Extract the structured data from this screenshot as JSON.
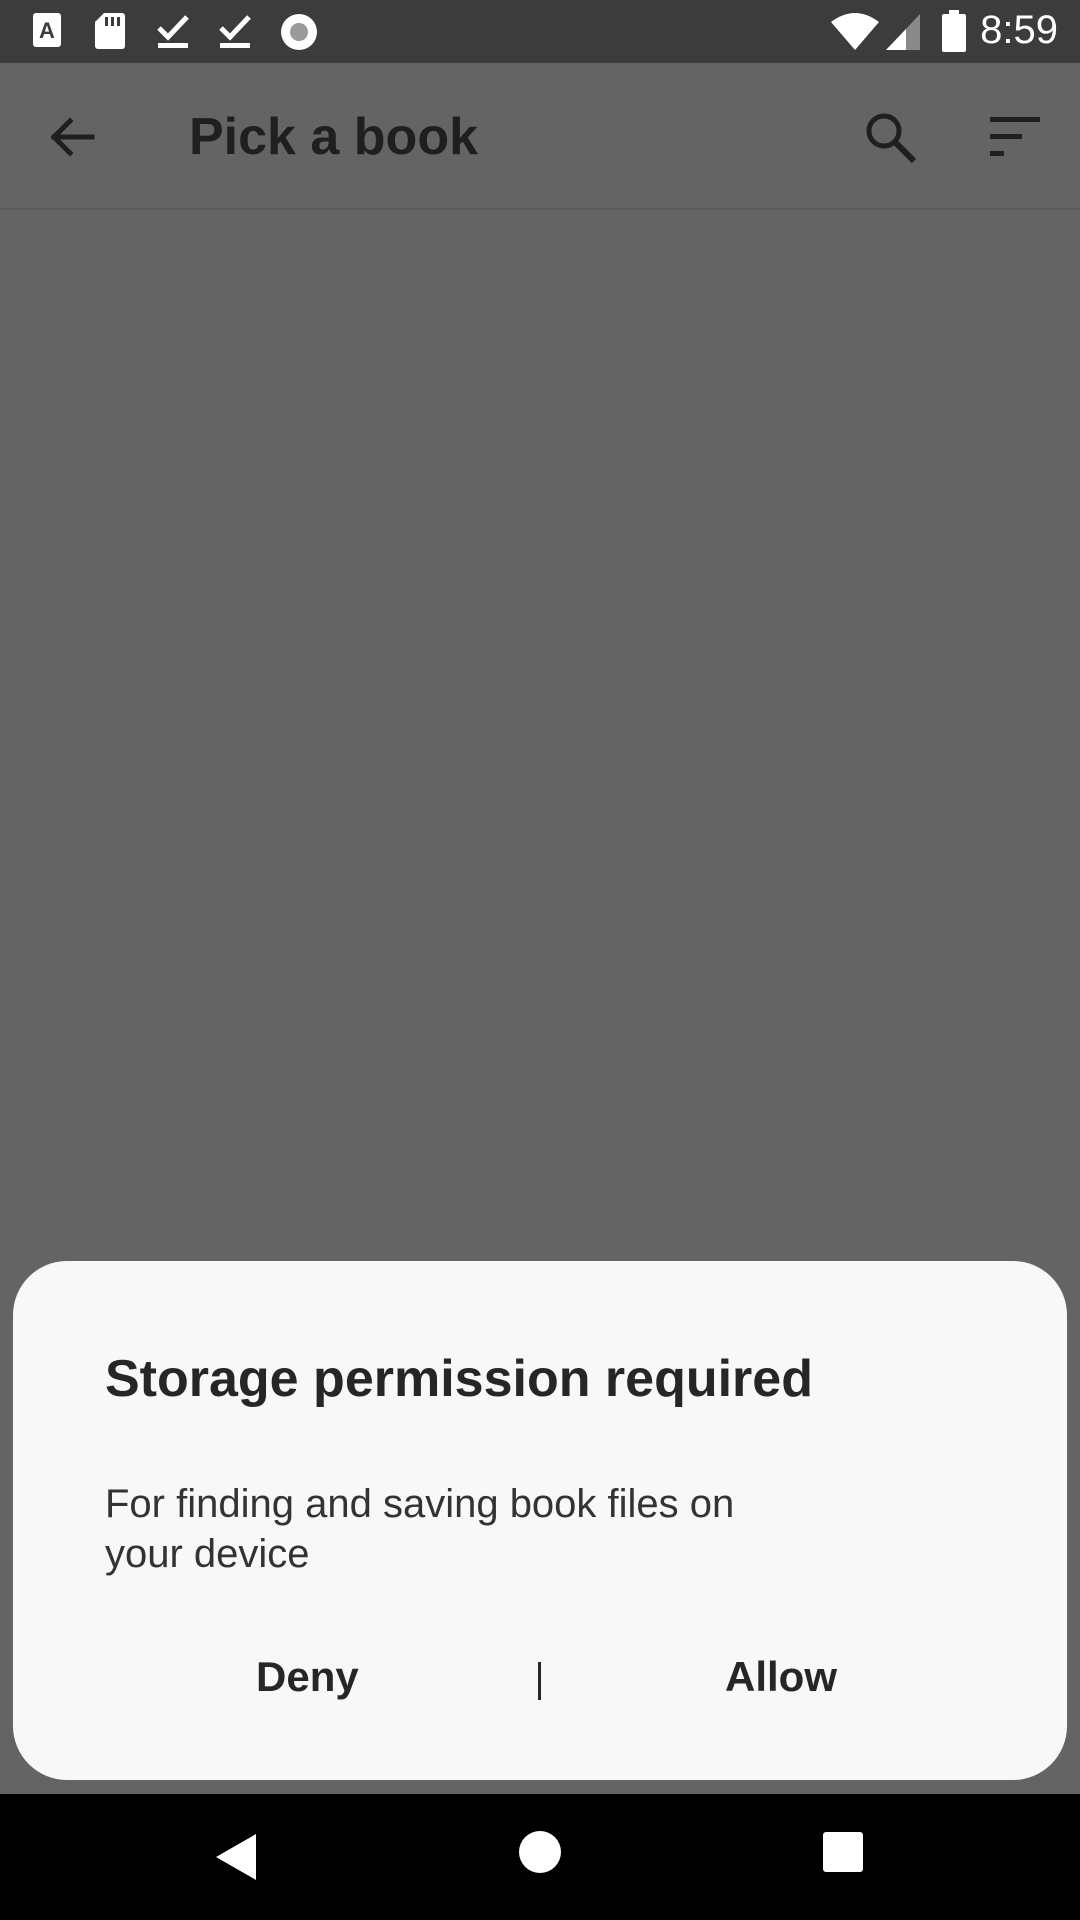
{
  "status_bar": {
    "time": "8:59",
    "icons": [
      "text-a-icon",
      "sd-card-icon",
      "download-done-icon",
      "download-done-icon",
      "record-icon",
      "wifi-icon",
      "signal-icon",
      "battery-icon"
    ]
  },
  "app_bar": {
    "title": "Pick a book",
    "icons": [
      "back-arrow-icon",
      "search-icon",
      "sort-icon"
    ]
  },
  "dialog": {
    "title": "Storage permission required",
    "body": "For finding and saving book files on your device",
    "deny_label": "Deny",
    "allow_label": "Allow"
  },
  "nav_bar": {
    "icons": [
      "back-triangle-icon",
      "home-circle-icon",
      "recents-square-icon"
    ]
  },
  "colors": {
    "status_bar": "#3c3c3c",
    "scrim": "#646464",
    "dialog_bg": "#f8f8f8",
    "text_dark": "#262626"
  }
}
